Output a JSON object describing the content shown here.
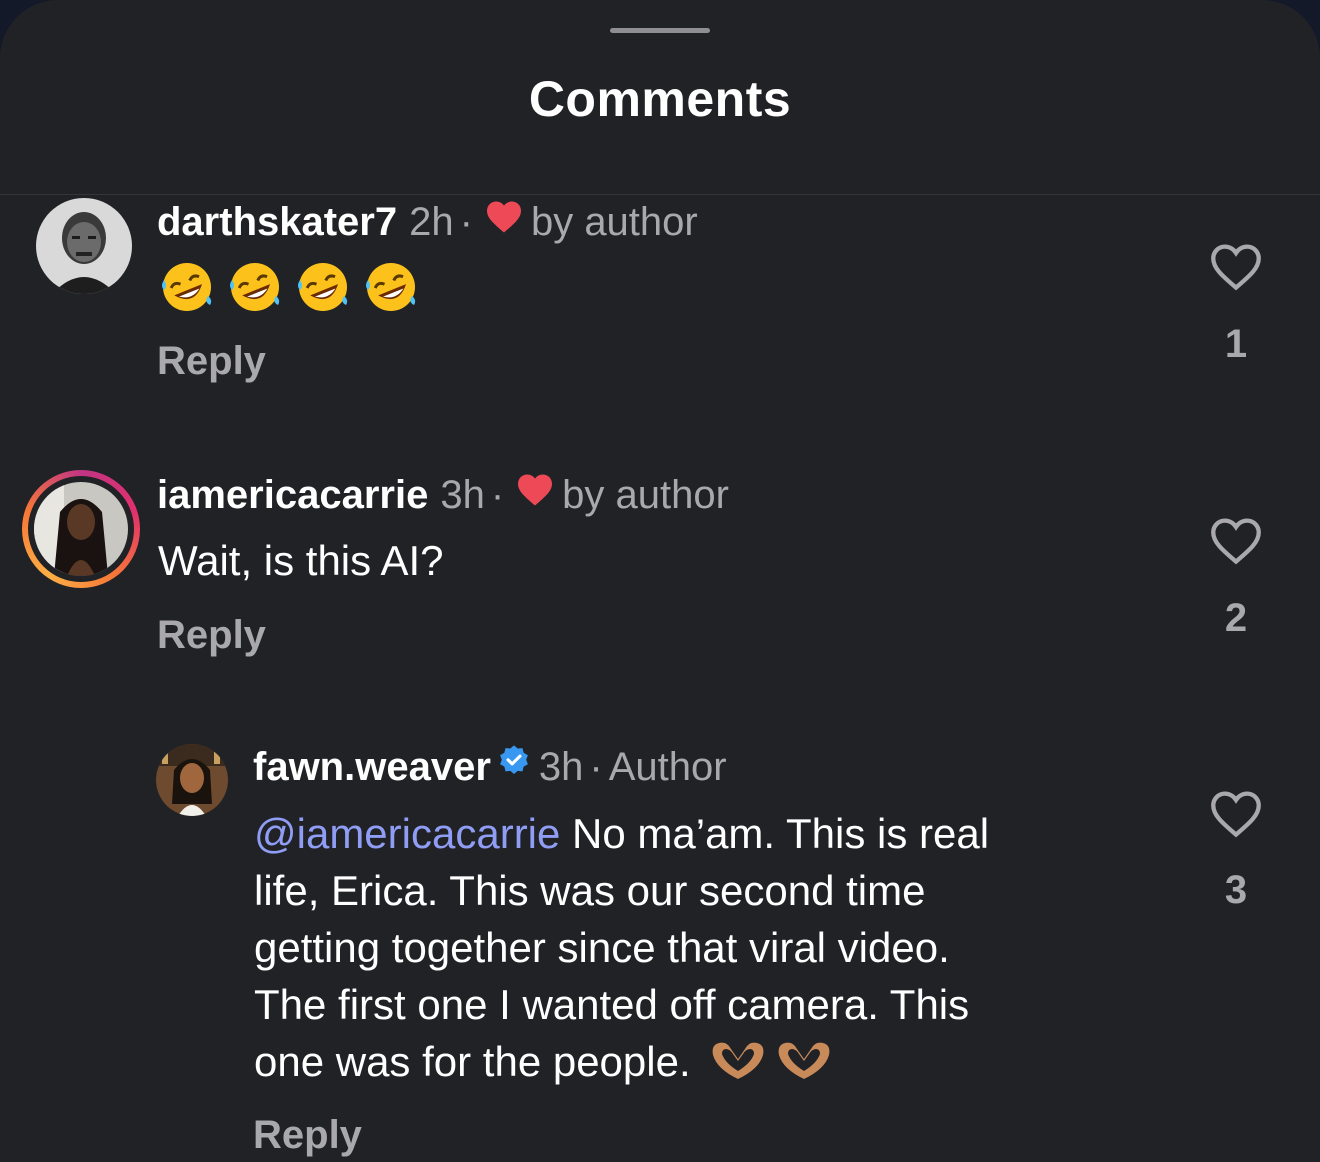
{
  "sheet": {
    "title": "Comments"
  },
  "comments": [
    {
      "username": "darthskater7",
      "time": "2h",
      "separator": "·",
      "liked_by_author": "by author",
      "emoji": [
        "rolling-on-floor-laughing-emoji",
        "rolling-on-floor-laughing-emoji",
        "rolling-on-floor-laughing-emoji",
        "rolling-on-floor-laughing-emoji"
      ],
      "reply_label": "Reply",
      "like_count": "1"
    },
    {
      "username": "iamericacarrie",
      "time": "3h",
      "separator": "·",
      "liked_by_author": "by author",
      "text": "Wait, is this AI?",
      "reply_label": "Reply",
      "like_count": "2",
      "has_story_ring": true
    },
    {
      "username": "fawn.weaver",
      "verified": true,
      "time": "3h",
      "separator": "·",
      "author_label": "Author",
      "mention": "@iamericacarrie",
      "lines": [
        " No ma’am. This is real",
        "life, Erica. This was our second time",
        "getting together since that viral video.",
        "The first one I wanted off camera. This",
        "one was for the people."
      ],
      "trailing_emoji": [
        "heart-hands-emoji",
        "heart-hands-emoji"
      ],
      "reply_label": "Reply",
      "like_count": "3"
    }
  ],
  "colors": {
    "background": "#212226",
    "mention": "#8f9df5",
    "heart_red": "#ed4956",
    "verified_blue": "#3897f0",
    "muted_text": "#a8a8ad"
  }
}
